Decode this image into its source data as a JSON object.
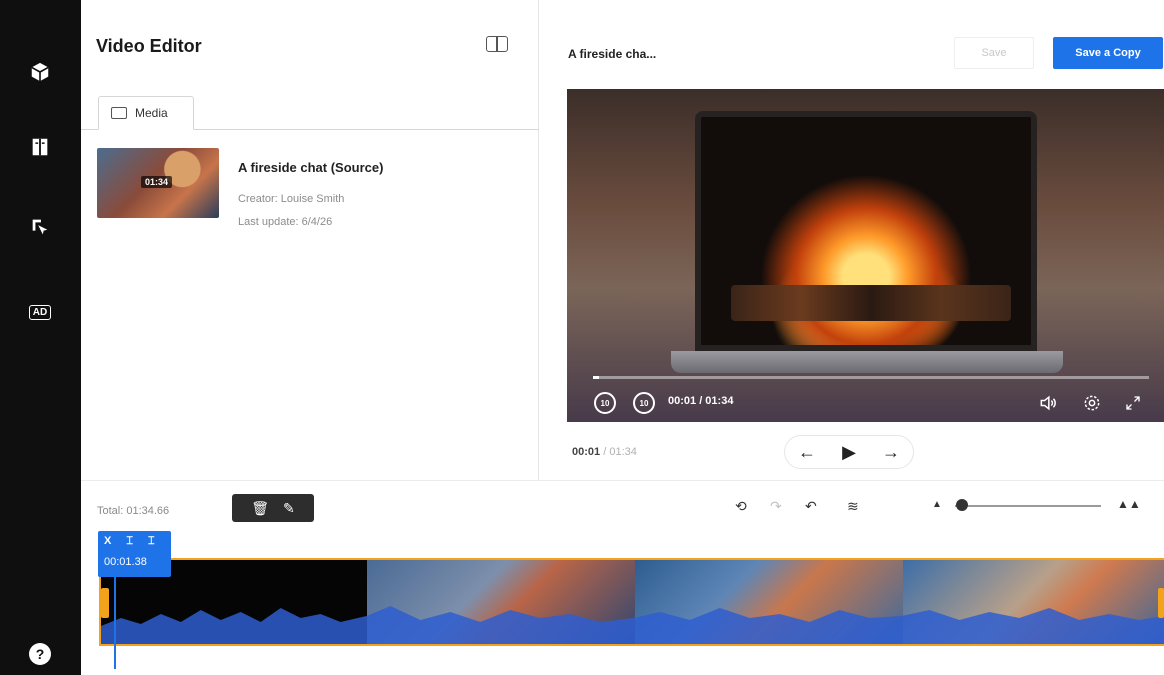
{
  "rail": {
    "items": [
      {
        "name": "cube-icon"
      },
      {
        "name": "book-icon"
      },
      {
        "name": "pointer-select-icon"
      },
      {
        "name": "audio-description-icon",
        "label": "AD"
      }
    ],
    "help_label": "?"
  },
  "left_panel": {
    "title": "Video Editor",
    "tab_label": "Media",
    "media": {
      "thumb_time": "01:34",
      "title": "A fireside chat (Source)",
      "creator": "Creator: Louise Smith",
      "last_update": "Last update: 6/4/26"
    }
  },
  "right_panel": {
    "video_name": "A fireside cha...",
    "save_label": "Save",
    "save_copy_label": "Save a Copy",
    "player": {
      "time_readout": "00:01 / 01:34",
      "progress_fraction": 0.01,
      "rewind_label": "10",
      "forward_label": "10"
    },
    "current_time": "00:01",
    "separator": "/",
    "total_time": "01:34",
    "nav": {
      "prev": "←",
      "play": "▶",
      "next": "→"
    }
  },
  "timeline": {
    "total_label": "Total: 01:34.66",
    "tools": {
      "delete": "🗑",
      "edit": "✎"
    },
    "history": {
      "reset": "⟲",
      "redo": "↷",
      "undo": "↶",
      "audio": "≋"
    },
    "zoom": {
      "small": "▲",
      "big": "▲▲",
      "level_fraction": 0.03
    },
    "clip_chip": {
      "icons": "X ⌶ ⌶",
      "time": "00:01.38"
    },
    "accent_color": "#1e73e8",
    "trim_color": "#f2a31b"
  }
}
